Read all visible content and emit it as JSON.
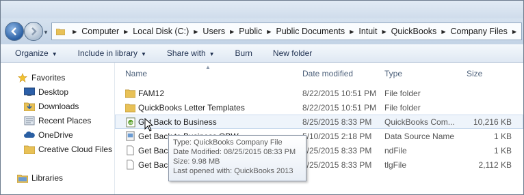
{
  "address": {
    "crumbs": [
      "Computer",
      "Local Disk (C:)",
      "Users",
      "Public",
      "Public Documents",
      "Intuit",
      "QuickBooks",
      "Company Files"
    ]
  },
  "toolbar": {
    "organize": "Organize",
    "include_in_library": "Include in library",
    "share_with": "Share with",
    "burn": "Burn",
    "new_folder": "New folder"
  },
  "nav": {
    "favorites": "Favorites",
    "items": [
      "Desktop",
      "Downloads",
      "Recent Places",
      "OneDrive",
      "Creative Cloud Files"
    ],
    "libraries": "Libraries"
  },
  "columns": {
    "name": "Name",
    "date": "Date modified",
    "type": "Type",
    "size": "Size"
  },
  "files": [
    {
      "name": "FAM12",
      "date": "8/22/2015 10:51 PM",
      "type": "File folder",
      "size": "",
      "icon": "folder-icon"
    },
    {
      "name": "QuickBooks Letter Templates",
      "date": "8/22/2015 10:51 PM",
      "type": "File folder",
      "size": "",
      "icon": "folder-icon"
    },
    {
      "name": "Get Back to Business",
      "date": "8/25/2015 8:33 PM",
      "type": "QuickBooks Com...",
      "size": "10,216 KB",
      "icon": "quickbooks-file-icon"
    },
    {
      "name": "Get Back to Business.QBW",
      "date": "5/10/2015 2:18 PM",
      "type": "Data Source Name",
      "size": "1 KB",
      "icon": "dsn-file-icon"
    },
    {
      "name": "Get Back",
      "date": "8/25/2015 8:33 PM",
      "type": "ndFile",
      "size": "1 KB",
      "icon": "file-icon"
    },
    {
      "name": "Get Back",
      "date": "8/25/2015 8:33 PM",
      "type": "tlgFile",
      "size": "2,112 KB",
      "icon": "file-icon"
    }
  ],
  "tooltip": {
    "type": "Type: QuickBooks Company File",
    "modified": "Date Modified: 08/25/2015 08:33 PM",
    "size": "Size: 9.98 MB",
    "opened": "Last opened with: QuickBooks 2013"
  },
  "colors": {
    "folder": "#e8c157",
    "accent": "#2a5fa3"
  }
}
